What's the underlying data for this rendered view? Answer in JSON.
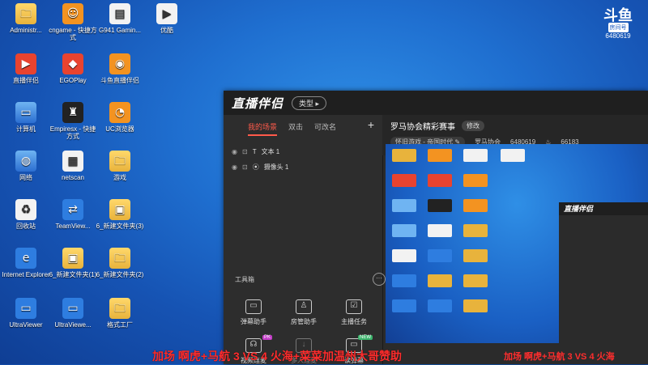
{
  "desktop": {
    "icons": [
      {
        "label": "Administr...",
        "symbol": "🗀",
        "style": "folder"
      },
      {
        "label": "cngame - 快捷方式",
        "symbol": "☺",
        "style": "app-orange"
      },
      {
        "label": "G941 Gamin...",
        "symbol": "▤",
        "style": "app-white"
      },
      {
        "label": "优酷",
        "symbol": "▶",
        "style": "app-white"
      },
      {
        "label": "直播伴侣",
        "symbol": "▶",
        "style": "app-red"
      },
      {
        "label": "EGOPlay",
        "symbol": "◆",
        "style": "app-red"
      },
      {
        "label": "斗鱼直播伴侣",
        "symbol": "◉",
        "style": "app-orange"
      },
      {
        "label": "计算机",
        "symbol": "▭",
        "style": "pc"
      },
      {
        "label": "Empiresx - 快捷方式",
        "symbol": "♜",
        "style": "app-dark"
      },
      {
        "label": "UC浏览器",
        "symbol": "◔",
        "style": "app-orange"
      },
      {
        "label": "网络",
        "symbol": "◍",
        "style": "pc"
      },
      {
        "label": "netscan",
        "symbol": "▦",
        "style": "app-white"
      },
      {
        "label": "游戏",
        "symbol": "🗀",
        "style": "folder"
      },
      {
        "label": "回收站",
        "symbol": "♻",
        "style": "app-white"
      },
      {
        "label": "TeamView...",
        "symbol": "⇄",
        "style": "app-blue"
      },
      {
        "label": "6_新建文件夹(3)",
        "symbol": "▣",
        "style": "folder"
      },
      {
        "label": "Internet Explorer",
        "symbol": "e",
        "style": "app-blue"
      },
      {
        "label": "6_新建文件夹(1)",
        "symbol": "▣",
        "style": "folder"
      },
      {
        "label": "6_新建文件夹(2)",
        "symbol": "🗀",
        "style": "folder"
      },
      {
        "label": "UltraViewer",
        "symbol": "▭",
        "style": "app-blue"
      },
      {
        "label": "UltraViewe...",
        "symbol": "▭",
        "style": "app-blue"
      },
      {
        "label": "格式工厂",
        "symbol": "🗀",
        "style": "folder"
      }
    ]
  },
  "watermark": {
    "logo": "斗鱼",
    "room_label": "房间号",
    "room_id": "6480619"
  },
  "window": {
    "logo": "直播伴侣",
    "type_button": "类型 ▸",
    "scene_tabs": [
      "我的场景",
      "双击",
      "可改名"
    ],
    "add_scene": "+",
    "sources": [
      "文本 1",
      "摄像头 1"
    ],
    "toolbox_title": "工具箱",
    "toolbox_more": "···",
    "tools": [
      {
        "label": "弹幕助手",
        "symbol": "▭"
      },
      {
        "label": "房管助手",
        "symbol": "♙"
      },
      {
        "label": "主播任务",
        "symbol": "☑"
      },
      {
        "label": "视频连麦",
        "symbol": "☊",
        "badge": "PK"
      },
      {
        "label": "多人连麦",
        "symbol": "↓",
        "dim": true
      },
      {
        "label": "读弹幕",
        "symbol": "▭",
        "badge": "NEW"
      }
    ],
    "room": {
      "title": "罗马协会精彩赛事",
      "edit": "修改",
      "category": "怀旧游戏 - 帝国时代 ✎",
      "name": "罗马协会",
      "id": "6480619",
      "heat": "66183"
    },
    "mini_logo": "直播伴侣"
  },
  "danmaku": {
    "main": "加场 啊虎+马航 3 VS 4 火海+菜菜加温州大哥赞助",
    "echo": "加场 啊虎+马航 3 VS 4 火海"
  }
}
